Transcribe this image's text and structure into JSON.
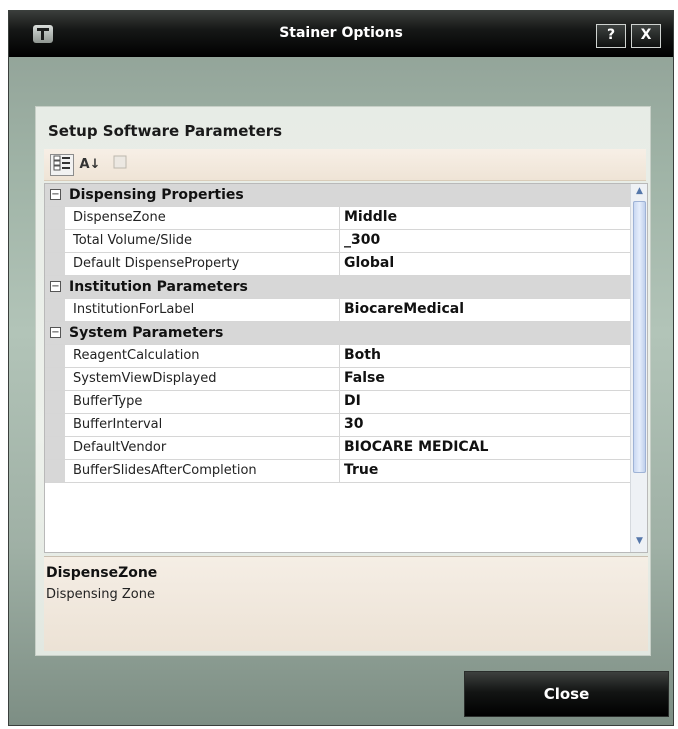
{
  "window": {
    "title": "Stainer Options",
    "help_label": "?",
    "close_label": "X"
  },
  "panel": {
    "heading": "Setup Software Parameters"
  },
  "toolbar": {
    "categorized_icon": "categorized-view-icon",
    "alphabetical_label": "A↓",
    "pages_icon": "property-pages-icon"
  },
  "grid": {
    "categories": [
      {
        "label": "Dispensing Properties",
        "toggle": "⊟",
        "rows": [
          {
            "name": "DispenseZone",
            "value": "Middle"
          },
          {
            "name": "Total Volume/Slide",
            "value": "_300"
          },
          {
            "name": "Default DispenseProperty",
            "value": "Global"
          }
        ]
      },
      {
        "label": "Institution Parameters",
        "toggle": "⊟",
        "rows": [
          {
            "name": "InstitutionForLabel",
            "value": "BiocareMedical"
          }
        ]
      },
      {
        "label": "System Parameters",
        "toggle": "⊟",
        "rows": [
          {
            "name": "ReagentCalculation",
            "value": "Both"
          },
          {
            "name": "SystemViewDisplayed",
            "value": "False"
          },
          {
            "name": "BufferType",
            "value": "DI"
          },
          {
            "name": "BufferInterval",
            "value": "30"
          },
          {
            "name": "DefaultVendor",
            "value": "BIOCARE MEDICAL"
          },
          {
            "name": "BufferSlidesAfterCompletion",
            "value": "True"
          }
        ]
      }
    ]
  },
  "description": {
    "title": "DispenseZone",
    "text": "Dispensing Zone"
  },
  "footer": {
    "close_label": "Close"
  }
}
